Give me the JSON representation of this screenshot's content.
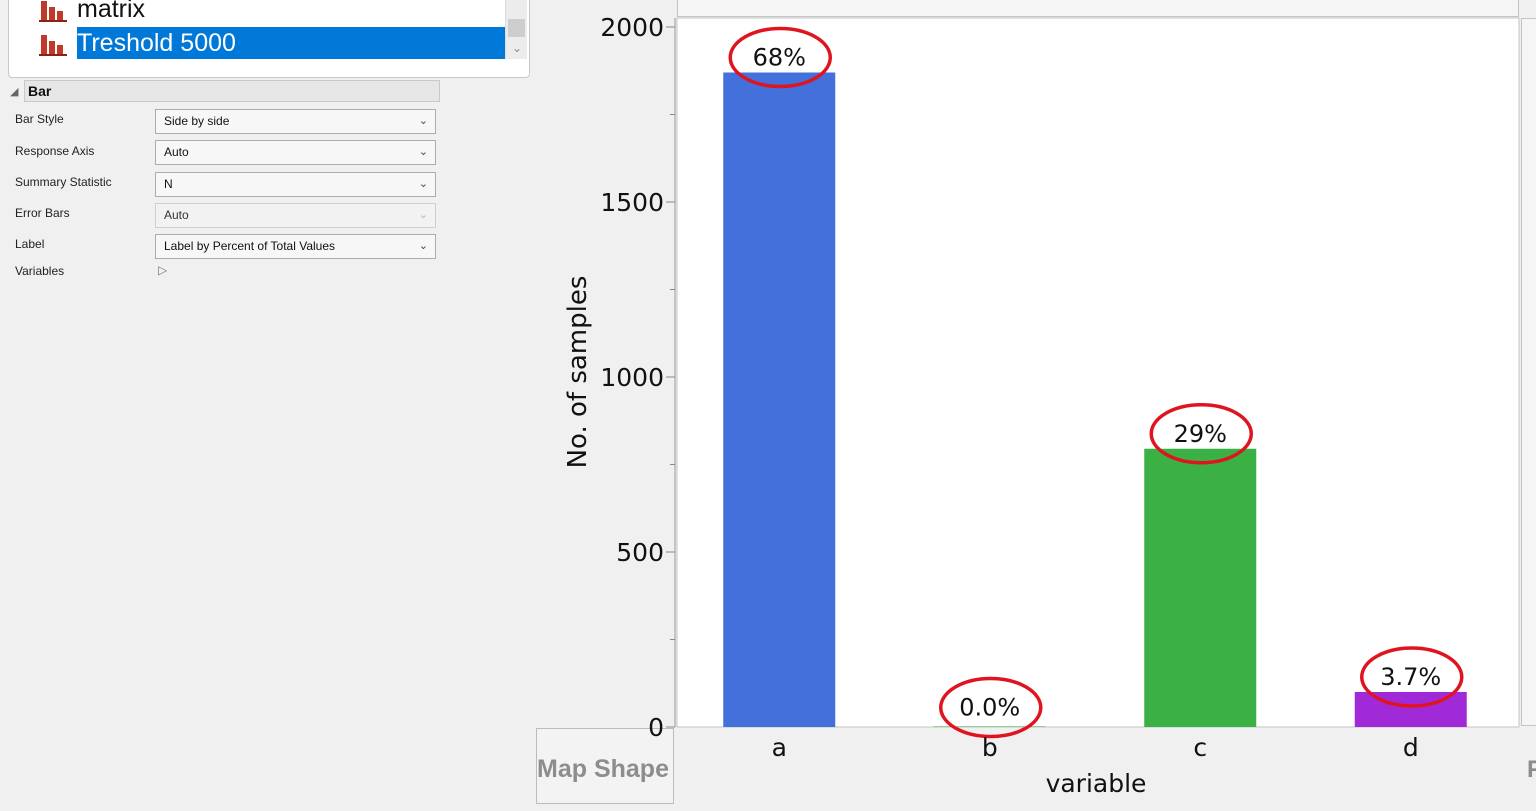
{
  "list": {
    "items": [
      {
        "label": "matrix",
        "selected": false
      },
      {
        "label": "Treshold 5000",
        "selected": true
      }
    ],
    "scroll_down_icon": "chevron-down-icon"
  },
  "bar_section": {
    "title": "Bar",
    "collapse_icon": "triangle-down-icon",
    "properties": [
      {
        "label": "Bar Style",
        "value": "Side by side",
        "enabled": true
      },
      {
        "label": "Response Axis",
        "value": "Auto",
        "enabled": true
      },
      {
        "label": "Summary Statistic",
        "value": "N",
        "enabled": true
      },
      {
        "label": "Error Bars",
        "value": "Auto",
        "enabled": false
      },
      {
        "label": "Label",
        "value": "Label by Percent of Total Values",
        "enabled": true
      }
    ],
    "variables_label": "Variables",
    "variables_icon": "triangle-right-icon"
  },
  "map_shape_label": "Map Shape",
  "cut_label": "F",
  "colors": {
    "selection": "#0078d7",
    "annotation_circle": "#e0141e",
    "bar_icon": "#c0392b"
  },
  "chart_data": {
    "type": "bar",
    "categories": [
      "a",
      "b",
      "c",
      "d"
    ],
    "values": [
      1870,
      0,
      795,
      100
    ],
    "data_labels": [
      "68%",
      "0.0%",
      "29%",
      "3.7%"
    ],
    "colors": [
      "#4370db",
      "#2aa02a",
      "#3bb045",
      "#a12ad8"
    ],
    "xlabel": "variable",
    "ylabel": "No. of samples",
    "ylim": [
      0,
      2000
    ],
    "yticks": [
      "0",
      "500",
      "1000",
      "1500",
      "2000"
    ],
    "grid": false,
    "annotations": "red ellipses drawn around each percent label"
  }
}
